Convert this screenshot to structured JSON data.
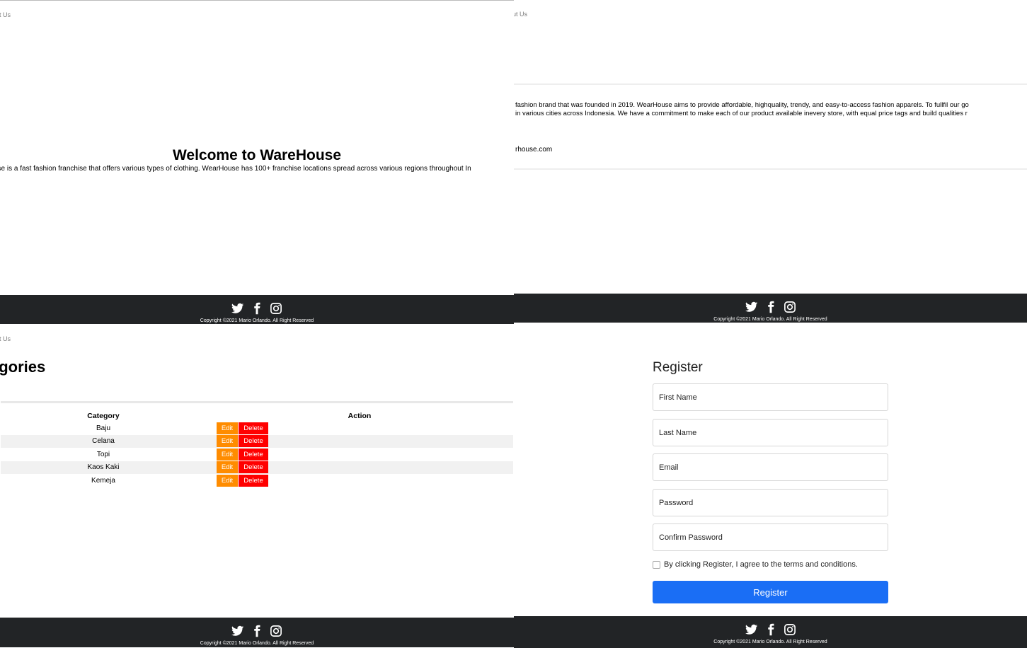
{
  "nav": {
    "about_link": "About Us",
    "about_link_cropped": "ut Us"
  },
  "footer": {
    "copyright": "Copyright ©2021 Mario Orlando. All Right Reserved",
    "icons": [
      "twitter-icon",
      "facebook-icon",
      "instagram-icon"
    ]
  },
  "home": {
    "title": "Welcome to WareHouse",
    "description": "use is a fast fashion franchise that offers various types of clothing. WearHouse has 100+ franchise locations spread across various regions throughout In"
  },
  "about": {
    "line1": "fashion brand that was founded in 2019. WearHouse aims to provide affordable, highquality, trendy, and easy-to-access fashion apparels. To fullfil our go",
    "line2": "in various cities across Indonesia. We have a commitment to make each of our product available inevery store, with equal price tags and build qualities r",
    "email": "rhouse.com"
  },
  "categories": {
    "title": "egories",
    "headers": {
      "category": "Category",
      "action": "Action"
    },
    "rows": [
      "Baju",
      "Celana",
      "Topi",
      "Kaos Kaki",
      "Kemeja"
    ],
    "edit_label": "Edit",
    "delete_label": "Delete"
  },
  "register": {
    "title": "Register",
    "fields": [
      "First Name",
      "Last Name",
      "Email",
      "Password",
      "Confirm Password"
    ],
    "terms": "By clicking Register, I agree to the terms and conditions.",
    "submit": "Register"
  },
  "colors": {
    "footer_bg": "#222426",
    "edit": "#ff8c00",
    "delete": "#ff0000",
    "primary": "#1a6ef5"
  }
}
